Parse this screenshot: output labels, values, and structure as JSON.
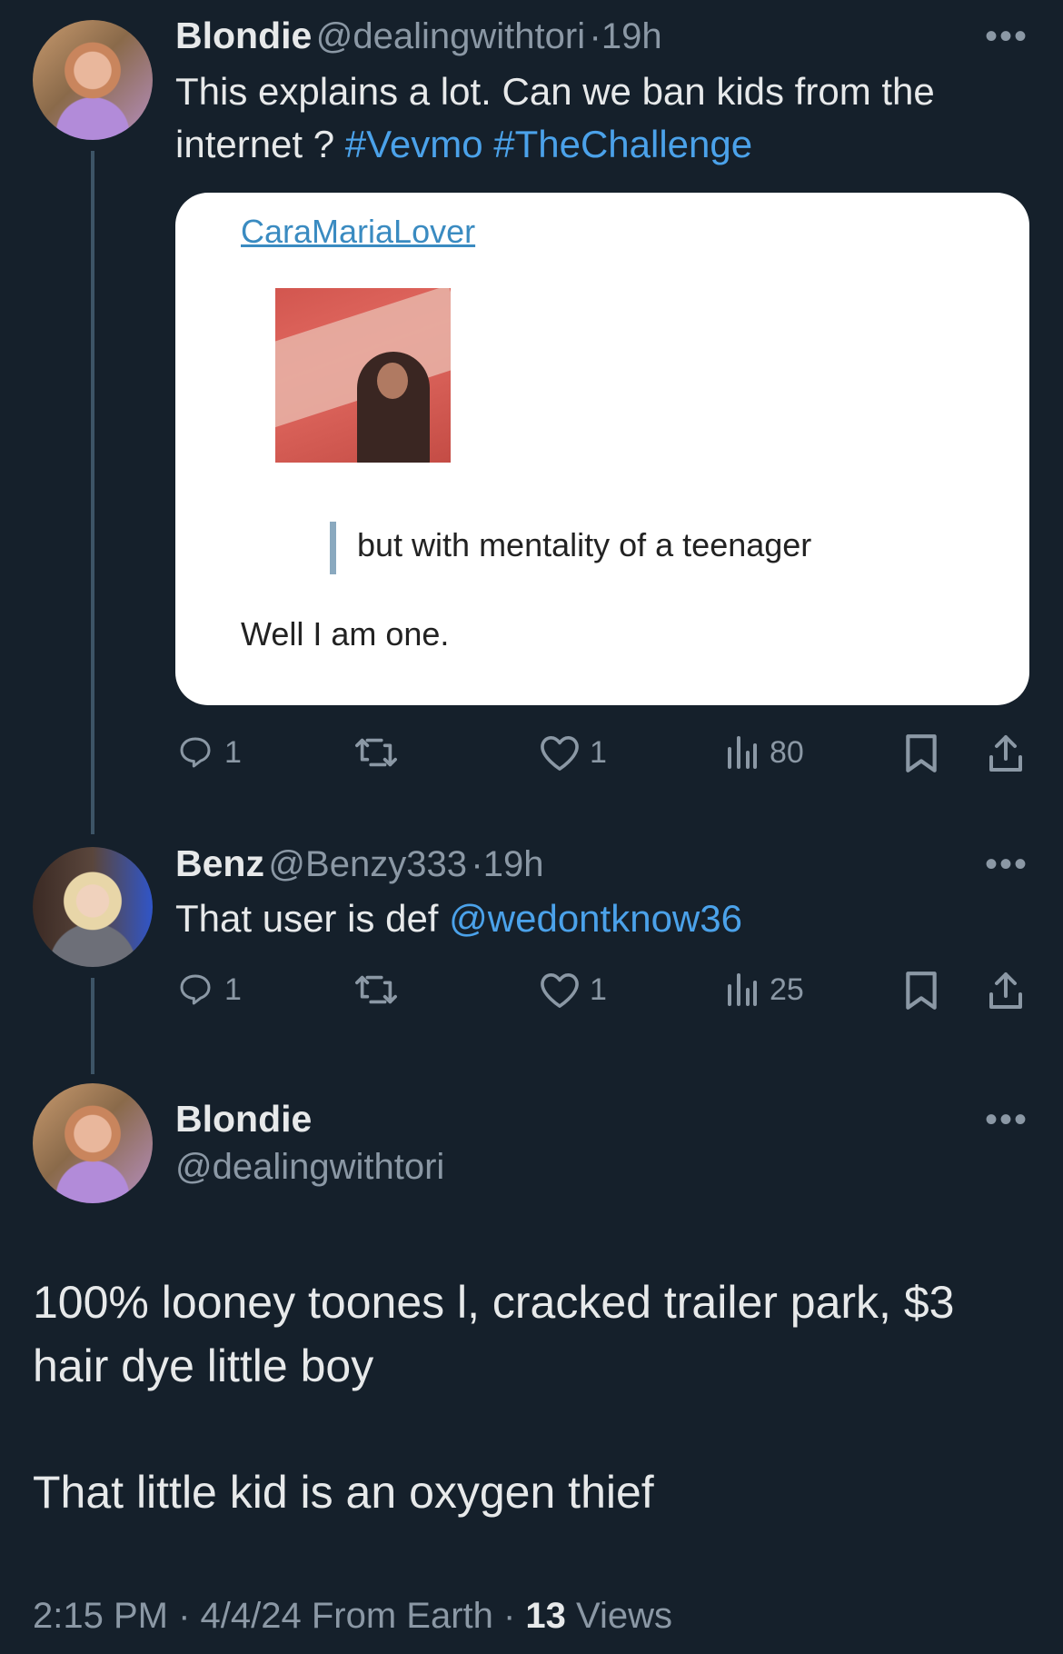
{
  "tweet1": {
    "display_name": "Blondie",
    "handle": "@dealingwithtori",
    "time": "19h",
    "text_plain": "This explains a lot. Can we ban kids from the internet ? ",
    "hashtag1": "#Vevmo",
    "hashtag2": "#TheChallenge",
    "card": {
      "username_link": "CaraMariaLover",
      "quote": "but with mentality of a teenager",
      "body": "Well I am one."
    },
    "stats": {
      "replies": "1",
      "likes": "1",
      "views": "80"
    }
  },
  "tweet2": {
    "display_name": "Benz",
    "handle": "@Benzy333",
    "time": "19h",
    "text_plain": "That user is def ",
    "mention": "@wedontknow36",
    "stats": {
      "replies": "1",
      "likes": "1",
      "views": "25"
    }
  },
  "main_tweet": {
    "display_name": "Blondie",
    "handle": "@dealingwithtori",
    "line1": "100% looney toones l, cracked trailer park, $3 hair dye little boy",
    "line2": "That little kid is an oxygen thief",
    "timestamp": "2:15 PM · 4/4/24 From Earth · ",
    "views_count": "13",
    "views_label": "Views"
  },
  "more_glyph": "•••",
  "colors": {
    "background": "#15202b",
    "link": "#4ba2ea",
    "muted": "#8b98a5"
  }
}
